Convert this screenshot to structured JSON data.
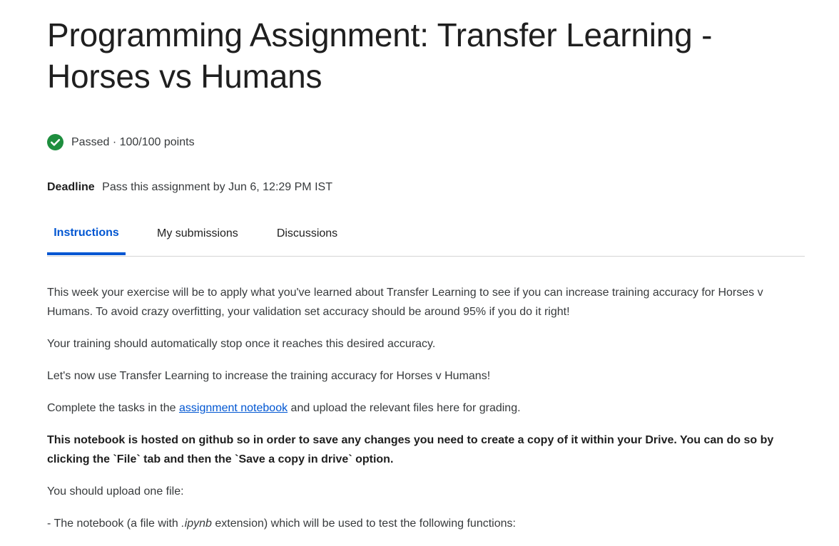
{
  "header": {
    "title": "Programming Assignment: Transfer Learning - Horses vs Humans"
  },
  "status": {
    "icon": "check-circle-icon",
    "icon_color": "#1e8e3e",
    "text": "Passed · 100/100 points"
  },
  "deadline": {
    "label": "Deadline",
    "text": "Pass this assignment by Jun 6, 12:29 PM IST"
  },
  "tabs": [
    {
      "label": "Instructions",
      "active": true
    },
    {
      "label": "My submissions",
      "active": false
    },
    {
      "label": "Discussions",
      "active": false
    }
  ],
  "colors": {
    "accent": "#0056d2",
    "text": "#1f1f1f",
    "body_text": "#373a3c",
    "divider": "#d5d5d5"
  },
  "content": {
    "p1": "This week your exercise will be to apply what you've learned about Transfer Learning to see if you can increase training accuracy for Horses v Humans. To avoid crazy overfitting, your validation set accuracy should be around 95% if you do it right!",
    "p2": "Your training should automatically stop once it reaches this desired accuracy.",
    "p3": "Let's now use Transfer Learning to increase the training accuracy for Horses v Humans!",
    "p4_before": "Complete the tasks in the ",
    "p4_link": "assignment notebook",
    "p4_after": " and upload the relevant files here for grading.",
    "p5": "This notebook is hosted on github so in order to save any changes you need to create a copy of it within your Drive. You can do so by clicking the `File` tab and then the `Save a copy in drive` option.",
    "p6": "You should upload one file:",
    "p7_before": "- The notebook (a file with ",
    "p7_ext": ".ipynb",
    "p7_after": " extension) which will be used to test the following functions:"
  }
}
